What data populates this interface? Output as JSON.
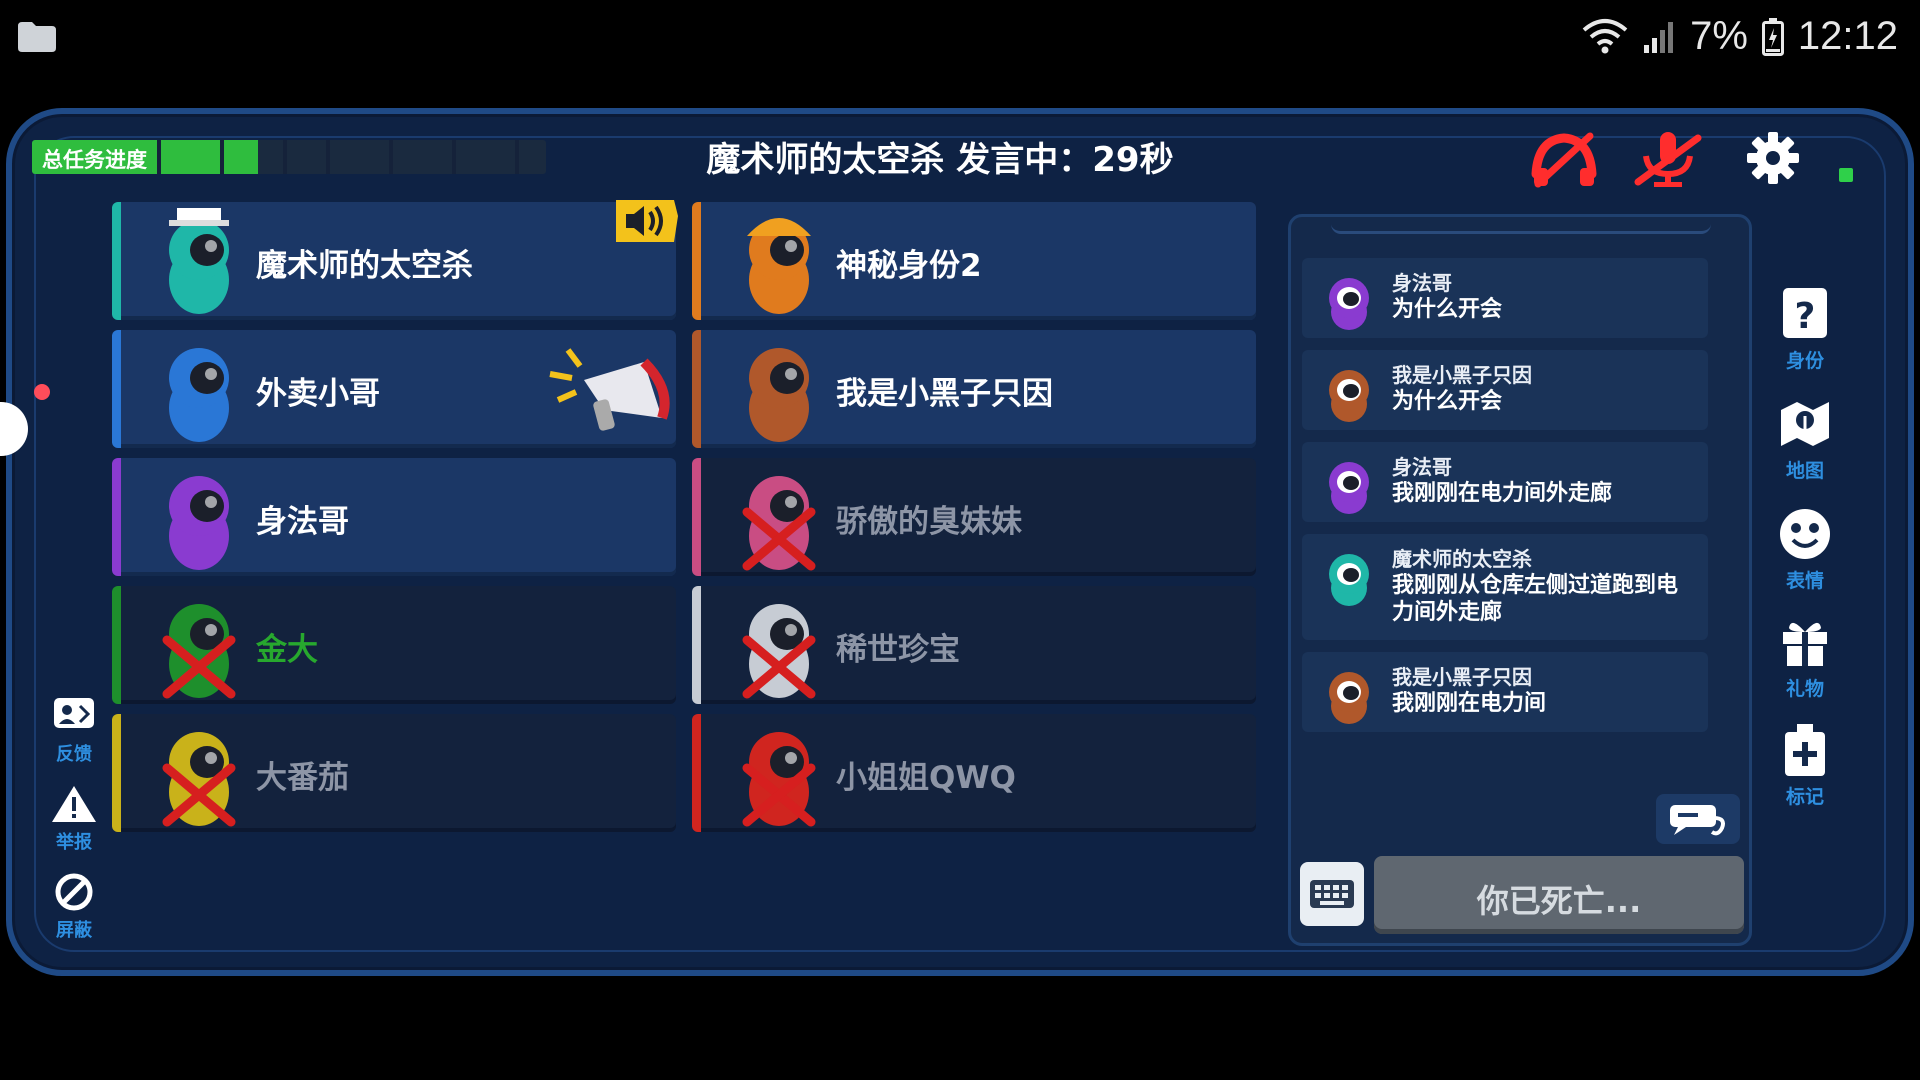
{
  "status_bar": {
    "battery_percent": "7%",
    "time": "12:12",
    "icons": [
      "folder-icon",
      "wifi-icon",
      "signal-icon",
      "battery-icon"
    ]
  },
  "progress": {
    "label": "总任务进度",
    "fraction": 0.44
  },
  "header": {
    "title": "魔术师的太空杀 发言中：29秒"
  },
  "players": [
    {
      "name": "魔术师的太空杀",
      "color": "#1fb7a8",
      "dead": false,
      "badge": "speaker-icon"
    },
    {
      "name": "神秘身份2",
      "color": "#e07b1e",
      "dead": false,
      "badge": ""
    },
    {
      "name": "外卖小哥",
      "color": "#2a77d6",
      "dead": false,
      "badge": "megaphone-icon"
    },
    {
      "name": "我是小黑子只因",
      "color": "#b0582b",
      "dead": false,
      "badge": ""
    },
    {
      "name": "身法哥",
      "color": "#8a3bd0",
      "dead": false,
      "badge": ""
    },
    {
      "name": "骄傲的臭妹妹",
      "color": "#c94d83",
      "dead": true,
      "badge": ""
    },
    {
      "name": "金大",
      "color": "#1e8f2c",
      "dead": true,
      "badge": ""
    },
    {
      "name": "稀世珍宝",
      "color": "#c7ccd4",
      "dead": true,
      "badge": ""
    },
    {
      "name": "大番茄",
      "color": "#c9b21a",
      "dead": true,
      "badge": ""
    },
    {
      "name": "小姐姐QWQ",
      "color": "#d0251f",
      "dead": true,
      "badge": ""
    }
  ],
  "chat": {
    "messages": [
      {
        "author": "身法哥",
        "text": "为什么开会",
        "color": "#8a3bd0"
      },
      {
        "author": "我是小黑子只因",
        "text": "为什么开会",
        "color": "#b0582b"
      },
      {
        "author": "身法哥",
        "text": "我刚刚在电力间外走廊",
        "color": "#8a3bd0"
      },
      {
        "author": "魔术师的太空杀",
        "text": "我刚刚从仓库左侧过道跑到电力间外走廊",
        "color": "#1fb7a8"
      },
      {
        "author": "我是小黑子只因",
        "text": "我刚刚在电力间",
        "color": "#b0582b"
      }
    ],
    "dead_notice": "你已死亡..."
  },
  "right_nav": [
    {
      "label": "身份",
      "icon": "identity-card-icon"
    },
    {
      "label": "地图",
      "icon": "map-icon"
    },
    {
      "label": "表情",
      "icon": "emoji-icon"
    },
    {
      "label": "礼物",
      "icon": "gift-icon"
    },
    {
      "label": "标记",
      "icon": "mark-icon"
    }
  ],
  "left_nav": [
    {
      "label": "反馈",
      "icon": "feedback-icon"
    },
    {
      "label": "举报",
      "icon": "warning-icon"
    },
    {
      "label": "屏蔽",
      "icon": "block-icon"
    }
  ]
}
